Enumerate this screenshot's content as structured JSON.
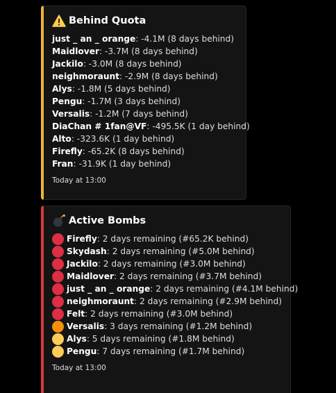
{
  "quota": {
    "accent_color": "#f0b232",
    "icon": "warning-icon",
    "title": "Behind Quota",
    "entries": [
      {
        "name": "just _ an _ orange",
        "text": ": -4.1M (8 days behind)"
      },
      {
        "name": "Maidlover",
        "text": ": -3.7M (8 days behind)"
      },
      {
        "name": "Jackilo",
        "text": ": -3.0M (8 days behind)"
      },
      {
        "name": "neighmoraunt",
        "text": ": -2.9M (8 days behind)"
      },
      {
        "name": "Alys",
        "text": ": -1.8M (5 days behind)"
      },
      {
        "name": "Pengu",
        "text": ": -1.7M (3 days behind)"
      },
      {
        "name": "Versalis",
        "text": ": -1.2M (7 days behind)"
      },
      {
        "name": "DiaChan # 1fan@VF",
        "text": ": -495.5K (1 day behind)"
      },
      {
        "name": "Alto",
        "text": ": -323.6K (1 day behind)"
      },
      {
        "name": "Firefly",
        "text": ": -65.2K (8 days behind)"
      },
      {
        "name": "Fran",
        "text": ": -31.9K (1 day behind)"
      }
    ],
    "footer": "Today at 13:00"
  },
  "bombs": {
    "accent_color": "#da373c",
    "icon": "bomb-icon",
    "title": "Active Bombs",
    "entries": [
      {
        "color": "#dd2e44",
        "name": "Firefly",
        "text": ": 2 days remaining (#65.2K behind)"
      },
      {
        "color": "#dd2e44",
        "name": "Skydash",
        "text": ": 2 days remaining (#5.0M behind)"
      },
      {
        "color": "#dd2e44",
        "name": "Jackilo",
        "text": ": 2 days remaining (#3.0M behind)"
      },
      {
        "color": "#dd2e44",
        "name": "Maidlover",
        "text": ": 2 days remaining (#3.7M behind)"
      },
      {
        "color": "#dd2e44",
        "name": "just _ an _ orange",
        "text": ": 2 days remaining (#4.1M behind)"
      },
      {
        "color": "#dd2e44",
        "name": "neighmoraunt",
        "text": ": 2 days remaining (#2.9M behind)"
      },
      {
        "color": "#dd2e44",
        "name": "Felt",
        "text": ": 2 days remaining (#3.0M behind)"
      },
      {
        "color": "#f4900c",
        "name": "Versalis",
        "text": ": 3 days remaining (#1.2M behind)"
      },
      {
        "color": "#fdcb58",
        "name": "Alys",
        "text": ": 5 days remaining (#1.8M behind)"
      },
      {
        "color": "#fdcb58",
        "name": "Pengu",
        "text": ": 7 days remaining (#1.7M behind)"
      }
    ],
    "footer": "Today at 13:00"
  }
}
